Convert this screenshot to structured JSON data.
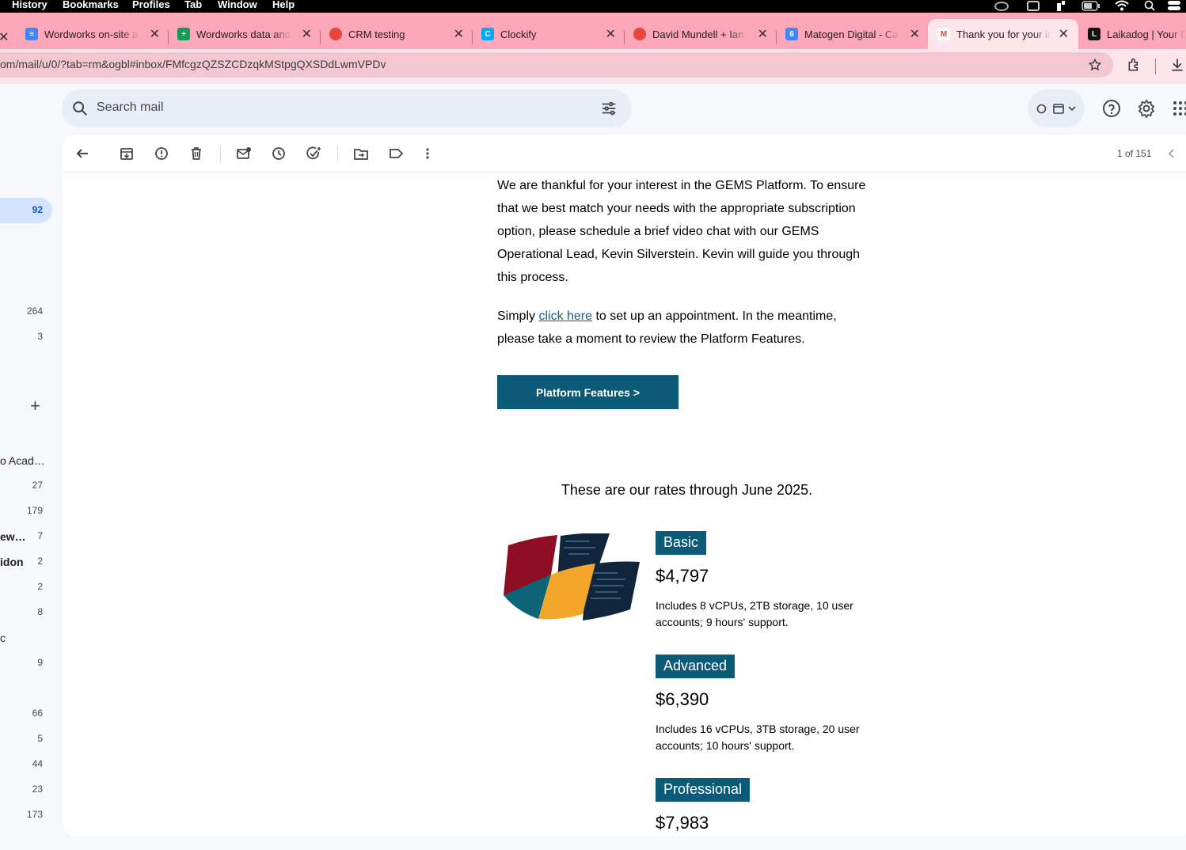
{
  "menubar": {
    "items": [
      "History",
      "Bookmarks",
      "Profiles",
      "Tab",
      "Window",
      "Help"
    ]
  },
  "tabs": [
    {
      "title": "Wordworks on-site a",
      "fav": "docs-icon",
      "color": "#4285f4"
    },
    {
      "title": "Wordworks data and",
      "fav": "sheets-icon",
      "color": "#0f9d58"
    },
    {
      "title": "CRM testing",
      "fav": "crm-icon",
      "color": "#e8453c"
    },
    {
      "title": "Clockify",
      "fav": "clockify-icon",
      "color": "#03a9f4"
    },
    {
      "title": "David Mundell + Ian F",
      "fav": "meeting-icon",
      "color": "#e8453c"
    },
    {
      "title": "Matogen Digital - Cal",
      "fav": "calendar-icon",
      "color": "#4285f4"
    },
    {
      "title": "Thank you for your in",
      "fav": "gmail-icon",
      "color": "#ea4335"
    },
    {
      "title": "Laikadog | Your Q",
      "fav": "laikadog-icon",
      "color": "#111111"
    }
  ],
  "address": {
    "url": "om/mail/u/0/?tab=rm&ogbl#inbox/FMfcgzQZSZCDzqkMStpgQXSDdLwmVPDv"
  },
  "search": {
    "placeholder": "Search mail"
  },
  "nav": {
    "inbox_count": "92",
    "counts": [
      {
        "label": "",
        "count": "264"
      },
      {
        "label": "",
        "count": "3"
      },
      {
        "label": "o Acad…",
        "count": ""
      },
      {
        "label": "",
        "count": "27"
      },
      {
        "label": "",
        "count": "179"
      },
      {
        "label": "ew…",
        "count": "7"
      },
      {
        "label": "idon",
        "count": "2"
      },
      {
        "label": "",
        "count": "2"
      },
      {
        "label": "",
        "count": "8"
      },
      {
        "label": "c",
        "count": ""
      },
      {
        "label": "",
        "count": "9"
      },
      {
        "label": "",
        "count": "66"
      },
      {
        "label": "",
        "count": "5"
      },
      {
        "label": "",
        "count": "44"
      },
      {
        "label": "",
        "count": "23"
      },
      {
        "label": "",
        "count": "173"
      }
    ],
    "add_label": "+"
  },
  "pager": {
    "text": "1 of 151"
  },
  "email": {
    "intro": "We are thankful for your interest in the GEMS Platform. To ensure that we best match your needs with the appropriate subscription option, please schedule a brief video chat with our GEMS Operational Lead, Kevin Silverstein. Kevin will guide you through this process.",
    "p2_before": "Simply ",
    "p2_link": "click here",
    "p2_after": " to set up an appointment. In the meantime, please take a moment to review the Platform Features.",
    "cta": "Platform Features >",
    "rates_heading": "These are our rates through June 2025.",
    "plans": [
      {
        "name": "Basic",
        "price": "$4,797",
        "desc": "Includes 8 vCPUs, 2TB storage, 10 user accounts; 9 hours' support."
      },
      {
        "name": "Advanced",
        "price": "$6,390",
        "desc": "Includes 16 vCPUs, 3TB storage, 20 user accounts; 10 hours' support."
      },
      {
        "name": "Professional",
        "price": "$7,983",
        "desc": ""
      }
    ]
  },
  "colors": {
    "tabstrip": "#fba7b9",
    "accent": "#0b5b78",
    "link": "#135f8a"
  }
}
